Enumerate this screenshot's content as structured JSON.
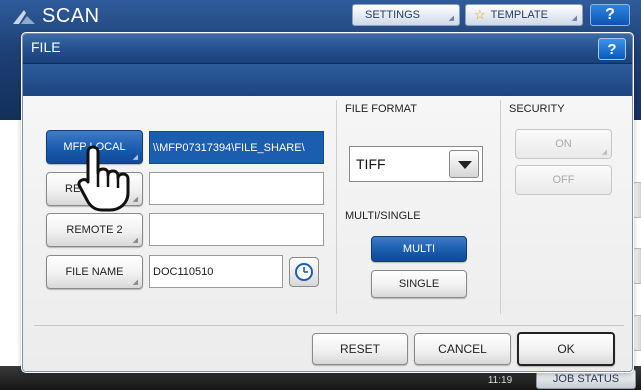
{
  "background": {
    "screen_title": "SCAN",
    "settings_label": "SETTINGS",
    "template_label": "TEMPLATE",
    "help_label": "?",
    "time": "11:19",
    "job_status_label": "JOB STATUS"
  },
  "dialog": {
    "title": "FILE",
    "help_label": "?",
    "destinations": {
      "mfp_local_label": "MFP LOCAL",
      "mfp_local_path": "\\\\MFP07317394\\FILE_SHARE\\",
      "remote1_label": "RE",
      "remote1_value": "",
      "remote2_label": "REMOTE 2",
      "remote2_value": "",
      "file_name_label": "FILE NAME",
      "file_name_value": "DOC110510"
    },
    "file_format": {
      "heading": "FILE FORMAT",
      "selected": "TIFF"
    },
    "multi_single": {
      "heading": "MULTI/SINGLE",
      "multi_label": "MULTI",
      "single_label": "SINGLE",
      "active": "MULTI"
    },
    "security": {
      "heading": "SECURITY",
      "on_label": "ON",
      "off_label": "OFF"
    },
    "footer": {
      "reset_label": "RESET",
      "cancel_label": "CANCEL",
      "ok_label": "OK"
    }
  },
  "colors": {
    "accent_blue": "#1b5dae",
    "title_bar": "#234f8c"
  }
}
